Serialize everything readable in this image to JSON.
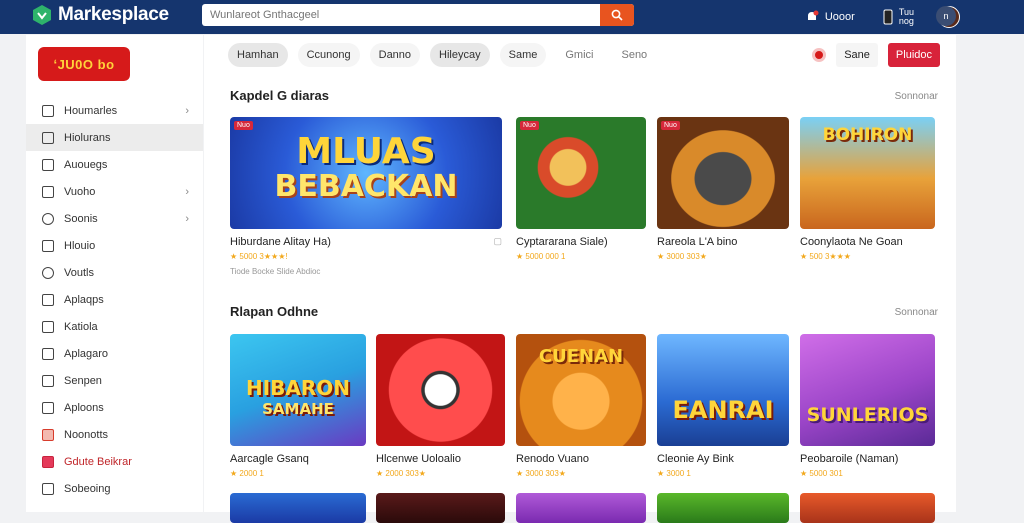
{
  "header": {
    "brand": "Markesplace",
    "search_placeholder": "Wunlareot Gnthacgeel",
    "notifications_label": "Uooor",
    "account_label": "Tuu\nnog",
    "menu_label": "n"
  },
  "sidebar": {
    "logo_text": "ʻJU0O bo",
    "items": [
      {
        "label": "Houmarles",
        "icon": "home-icon",
        "chevron": true
      },
      {
        "label": "Hiolurans",
        "icon": "list-icon",
        "active": true
      },
      {
        "label": "Auouegs",
        "icon": "bag-icon"
      },
      {
        "label": "Vuoho",
        "icon": "box-icon",
        "chevron": true
      },
      {
        "label": "Soonis",
        "icon": "circle-icon",
        "chevron": true
      },
      {
        "label": "Hlouio",
        "icon": "doc-icon"
      },
      {
        "label": "Voutls",
        "icon": "target-icon"
      },
      {
        "label": "Aplaqps",
        "icon": "app-icon"
      },
      {
        "label": "Katiola",
        "icon": "grid-icon"
      },
      {
        "label": "Aplagaro",
        "icon": "tag-icon"
      },
      {
        "label": "Senpen",
        "icon": "bell-icon"
      },
      {
        "label": "Aploons",
        "icon": "chat-icon"
      },
      {
        "label": "Noonotts",
        "icon": "gift-icon"
      },
      {
        "label": "Gdute Beikrar",
        "icon": "mail-icon",
        "highlight": true
      },
      {
        "label": "Sobeoing",
        "icon": "settings-icon"
      }
    ]
  },
  "tabs": [
    {
      "label": "Hamhan",
      "active": true
    },
    {
      "label": "Ccunong"
    },
    {
      "label": "Danno"
    },
    {
      "label": "Hileycay",
      "active": true
    },
    {
      "label": "Same"
    },
    {
      "label": "Gmici",
      "muted": true
    },
    {
      "label": "Seno",
      "muted": true
    }
  ],
  "actions": {
    "secondary": "Sane",
    "primary": "Pluidoc"
  },
  "section1": {
    "title": "Kapdel G diaras",
    "see_all": "Sonnonar",
    "cards": [
      {
        "title": "Hiburdane Alitay Ha)",
        "rating": "★ 5000 3★★★!",
        "sub": "Tiode Bocke Slide Abdioc",
        "badge": "Nuo",
        "art_line1": "MLUAS",
        "art_line2": "BEBACKAN",
        "bg": "#2a5bd7"
      },
      {
        "title": "Cyptararana Siale)",
        "rating": "★ 5000 000 1",
        "badge": "Nuo",
        "bg": "#2a7a2a"
      },
      {
        "title": "Rareola L'A bino",
        "rating": "★ 3000 303★",
        "badge": "Nuo",
        "bg": "#6a3412"
      },
      {
        "title": "Coonylaota Ne Goan",
        "rating": "★ 500 3★★★",
        "art_line1": "BOHIRON",
        "art_line2": "",
        "bg": "#e8a23a"
      }
    ]
  },
  "section2": {
    "title": "Rlapan Odhne",
    "see_all": "Sonnonar",
    "cards": [
      {
        "title": "Aarcagle Gsanq",
        "rating": "★ 2000 1",
        "art_line1": "HIBARON",
        "art_line2": "SAMAHE",
        "bg": "#29a0e0"
      },
      {
        "title": "Hlcenwe Uoloalio",
        "rating": "★ 2000 303★",
        "bg": "#d42525"
      },
      {
        "title": "Renodo Vuano",
        "rating": "★ 3000 303★",
        "art_line1": "CUENAN",
        "art_line2": "",
        "bg": "#e68a1d"
      },
      {
        "title": "Cleonie Ay Bink",
        "rating": "★ 3000 1",
        "art_line1": "EANRAI",
        "art_line2": "",
        "bg": "#2b6bd3"
      },
      {
        "title": "Peobaroile (Naman)",
        "rating": "★ 5000 301",
        "art_line1": "SUNLERIOS",
        "art_line2": "",
        "bg": "#9b45c8"
      }
    ]
  },
  "colors": {
    "topbar": "#15356e",
    "accent_red": "#d8233a",
    "search_button": "#e8541f"
  }
}
